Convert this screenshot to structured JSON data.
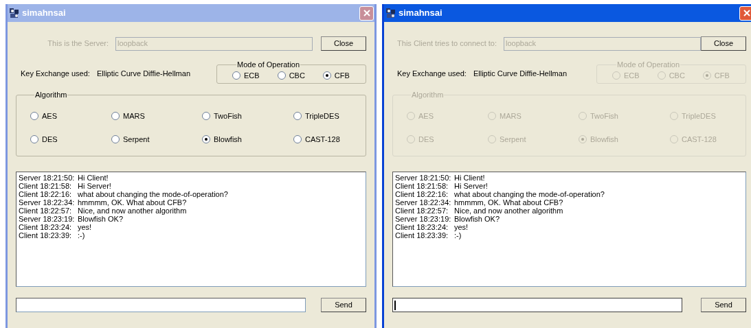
{
  "windows": [
    {
      "title": "simahnsai",
      "active": false,
      "host_label": "This is the Server:",
      "host_value": "loopback",
      "close_button": "Close",
      "key_exchange_label": "Key Exchange used:",
      "key_exchange_value": "Elliptic Curve Diffie-Hellman",
      "settings_disabled": false,
      "mode_group": {
        "title": "Mode of Operation",
        "options": [
          {
            "label": "ECB",
            "selected": false
          },
          {
            "label": "CBC",
            "selected": false
          },
          {
            "label": "CFB",
            "selected": true
          }
        ]
      },
      "algorithm_group": {
        "title": "Algorithm",
        "options": [
          {
            "label": "AES",
            "selected": false
          },
          {
            "label": "MARS",
            "selected": false
          },
          {
            "label": "TwoFish",
            "selected": false
          },
          {
            "label": "TripleDES",
            "selected": false
          },
          {
            "label": "DES",
            "selected": false
          },
          {
            "label": "Serpent",
            "selected": false
          },
          {
            "label": "Blowfish",
            "selected": true
          },
          {
            "label": "CAST-128",
            "selected": false
          }
        ]
      },
      "messages": [
        {
          "sender": "Server 18:21:50:",
          "text": "Hi Client!"
        },
        {
          "sender": "Client 18:21:58:",
          "text": "Hi Server!"
        },
        {
          "sender": "Client 18:22:16:",
          "text": "what about changing the mode-of-operation?"
        },
        {
          "sender": "Server 18:22:34:",
          "text": "hmmmm, OK. What about CFB?"
        },
        {
          "sender": "Client 18:22:57:",
          "text": "Nice, and now another algorithm"
        },
        {
          "sender": "Server 18:23:19:",
          "text": "Blowfish OK?"
        },
        {
          "sender": "Client 18:23:24:",
          "text": "yes!"
        },
        {
          "sender": "Client 18:23:39:",
          "text": ":-)"
        }
      ],
      "input_focused": false,
      "send_button": "Send"
    },
    {
      "title": "simahnsai",
      "active": true,
      "host_label": "This Client tries to connect to:",
      "host_value": "loopback",
      "close_button": "Close",
      "key_exchange_label": "Key Exchange used:",
      "key_exchange_value": "Elliptic Curve Diffie-Hellman",
      "settings_disabled": true,
      "mode_group": {
        "title": "Mode of Operation",
        "options": [
          {
            "label": "ECB",
            "selected": false
          },
          {
            "label": "CBC",
            "selected": false
          },
          {
            "label": "CFB",
            "selected": true
          }
        ]
      },
      "algorithm_group": {
        "title": "Algorithm",
        "options": [
          {
            "label": "AES",
            "selected": false
          },
          {
            "label": "MARS",
            "selected": false
          },
          {
            "label": "TwoFish",
            "selected": false
          },
          {
            "label": "TripleDES",
            "selected": false
          },
          {
            "label": "DES",
            "selected": false
          },
          {
            "label": "Serpent",
            "selected": false
          },
          {
            "label": "Blowfish",
            "selected": true
          },
          {
            "label": "CAST-128",
            "selected": false
          }
        ]
      },
      "messages": [
        {
          "sender": "Server 18:21:50:",
          "text": "Hi Client!"
        },
        {
          "sender": "Client 18:21:58:",
          "text": "Hi Server!"
        },
        {
          "sender": "Client 18:22:16:",
          "text": "what about changing the mode-of-operation?"
        },
        {
          "sender": "Server 18:22:34:",
          "text": "hmmmm, OK. What about CFB?"
        },
        {
          "sender": "Client 18:22:57:",
          "text": "Nice, and now another algorithm"
        },
        {
          "sender": "Server 18:23:19:",
          "text": "Blowfish OK?"
        },
        {
          "sender": "Client 18:23:24:",
          "text": "yes!"
        },
        {
          "sender": "Client 18:23:39:",
          "text": ":-)"
        }
      ],
      "input_focused": true,
      "send_button": "Send"
    }
  ]
}
